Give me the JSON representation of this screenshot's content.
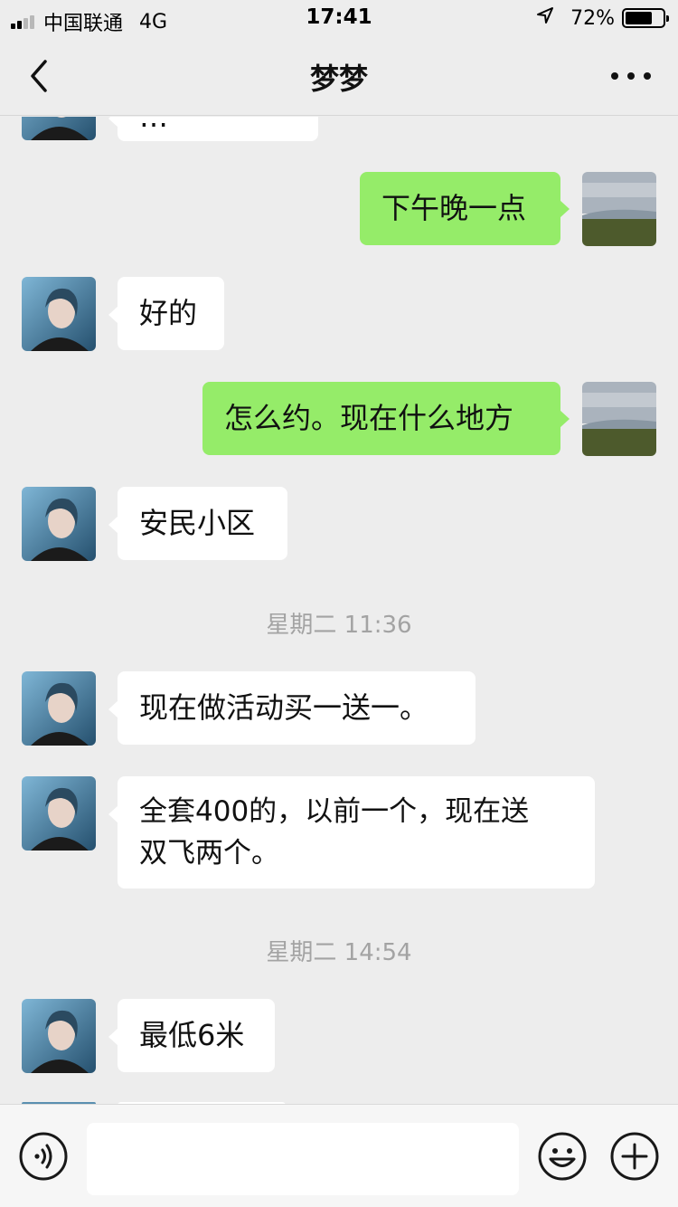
{
  "status_bar": {
    "carrier": "中国联通",
    "network": "4G",
    "time": "17:41",
    "battery_percent": "72%",
    "battery_level": 0.72
  },
  "header": {
    "title": "梦梦",
    "back_icon": "chevron-left-icon",
    "more_icon": "more-dots-icon"
  },
  "messages": [
    {
      "side": "in",
      "text": "…"
    },
    {
      "side": "out",
      "text": "下午晚一点"
    },
    {
      "side": "in",
      "text": "好的"
    },
    {
      "side": "out",
      "text": "怎么约。现在什么地方"
    },
    {
      "side": "in",
      "text": "安民小区"
    },
    {
      "timestamp": "星期二 11:36"
    },
    {
      "side": "in",
      "text": "现在做活动买一送一。"
    },
    {
      "side": "in",
      "text": "全套400的，以前一个，现在送\n双飞两个。"
    },
    {
      "timestamp": "星期二 14:54"
    },
    {
      "side": "in",
      "text": "最低6米"
    }
  ],
  "input_bar": {
    "voice_icon": "voice-icon",
    "emoji_icon": "emoji-icon",
    "plus_icon": "plus-icon",
    "input_value": ""
  },
  "colors": {
    "background": "#ededed",
    "outgoing_bubble": "#95ec69",
    "incoming_bubble": "#ffffff"
  }
}
